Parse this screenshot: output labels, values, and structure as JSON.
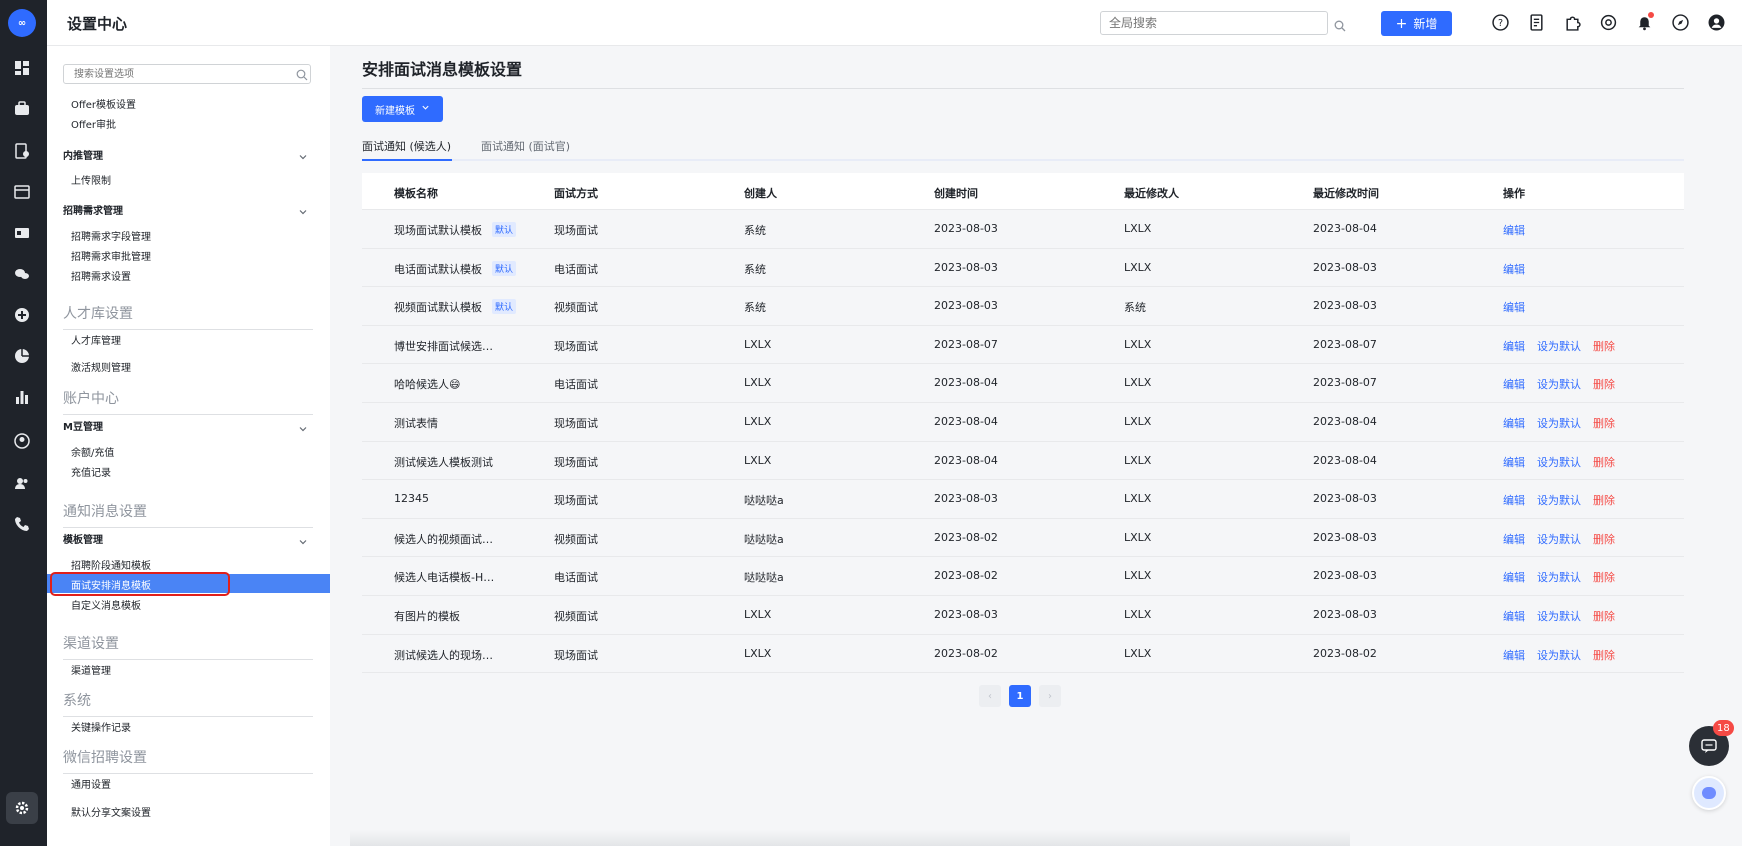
{
  "app": {
    "title": "设置中心",
    "logo_text": "∞"
  },
  "header": {
    "search_placeholder": "全局搜索",
    "new_label": "新增",
    "icons": [
      "help-icon",
      "doc-icon",
      "puzzle-icon",
      "support-icon",
      "bell-icon",
      "compass-icon",
      "user-icon"
    ]
  },
  "sidebar": {
    "search_placeholder": "搜索设置选项",
    "offer_template": "Offer模板设置",
    "offer_approval": "Offer审批",
    "referral_group": "内推管理",
    "upload_limit": "上传限制",
    "demand_group": "招聘需求管理",
    "demand_fields": "招聘需求字段管理",
    "demand_approval": "招聘需求审批管理",
    "demand_settings": "招聘需求设置",
    "talent_section": "人才库设置",
    "talent_mgmt": "人才库管理",
    "activation_rules": "激活规则管理",
    "account_section": "账户中心",
    "mbean_group": "M豆管理",
    "balance": "余额/充值",
    "recharge_records": "充值记录",
    "notify_section": "通知消息设置",
    "template_group": "模板管理",
    "stage_template": "招聘阶段通知模板",
    "interview_template": "面试安排消息模板",
    "custom_template": "自定义消息模板",
    "channel_section": "渠道设置",
    "channel_mgmt": "渠道管理",
    "system_section": "系统",
    "key_ops": "关键操作记录",
    "wechat_section": "微信招聘设置",
    "general": "通用设置",
    "share_copy": "默认分享文案设置"
  },
  "main": {
    "title": "安排面试消息模板设置",
    "new_template": "新建模板",
    "tabs": [
      "面试通知 (候选人)",
      "面试通知 (面试官)"
    ],
    "columns": [
      "模板名称",
      "面试方式",
      "创建人",
      "创建时间",
      "最近修改人",
      "最近修改时间",
      "操作"
    ],
    "default_badge": "默认",
    "action_edit": "编辑",
    "action_set_default": "设为默认",
    "action_delete": "删除",
    "rows": [
      {
        "name": "现场面试默认模板",
        "is_default": true,
        "method": "现场面试",
        "creator": "系统",
        "created": "2023-08-03",
        "modifier": "LXLX",
        "modified": "2023-08-04"
      },
      {
        "name": "电话面试默认模板",
        "is_default": true,
        "method": "电话面试",
        "creator": "系统",
        "created": "2023-08-03",
        "modifier": "LXLX",
        "modified": "2023-08-03"
      },
      {
        "name": "视频面试默认模板",
        "is_default": true,
        "method": "视频面试",
        "creator": "系统",
        "created": "2023-08-03",
        "modifier": "系统",
        "modified": "2023-08-03"
      },
      {
        "name": "博世安排面试候选…",
        "is_default": false,
        "method": "现场面试",
        "creator": "LXLX",
        "created": "2023-08-07",
        "modifier": "LXLX",
        "modified": "2023-08-07"
      },
      {
        "name": "哈哈候选人😄",
        "is_default": false,
        "method": "电话面试",
        "creator": "LXLX",
        "created": "2023-08-04",
        "modifier": "LXLX",
        "modified": "2023-08-07"
      },
      {
        "name": "测试表情",
        "is_default": false,
        "method": "现场面试",
        "creator": "LXLX",
        "created": "2023-08-04",
        "modifier": "LXLX",
        "modified": "2023-08-04"
      },
      {
        "name": "测试候选人模板测试",
        "is_default": false,
        "method": "现场面试",
        "creator": "LXLX",
        "created": "2023-08-04",
        "modifier": "LXLX",
        "modified": "2023-08-04"
      },
      {
        "name": "12345",
        "is_default": false,
        "method": "现场面试",
        "creator": "哒哒哒a",
        "created": "2023-08-03",
        "modifier": "LXLX",
        "modified": "2023-08-03"
      },
      {
        "name": "候选人的视频面试…",
        "is_default": false,
        "method": "视频面试",
        "creator": "哒哒哒a",
        "created": "2023-08-02",
        "modifier": "LXLX",
        "modified": "2023-08-03"
      },
      {
        "name": "候选人电话模板-H…",
        "is_default": false,
        "method": "电话面试",
        "creator": "哒哒哒a",
        "created": "2023-08-02",
        "modifier": "LXLX",
        "modified": "2023-08-03"
      },
      {
        "name": "有图片的模板",
        "is_default": false,
        "method": "视频面试",
        "creator": "LXLX",
        "created": "2023-08-03",
        "modifier": "LXLX",
        "modified": "2023-08-03"
      },
      {
        "name": "测试候选人的现场…",
        "is_default": false,
        "method": "现场面试",
        "creator": "LXLX",
        "created": "2023-08-02",
        "modifier": "LXLX",
        "modified": "2023-08-02"
      }
    ],
    "pagination": {
      "current": "1"
    }
  },
  "chat": {
    "unread": "18"
  }
}
